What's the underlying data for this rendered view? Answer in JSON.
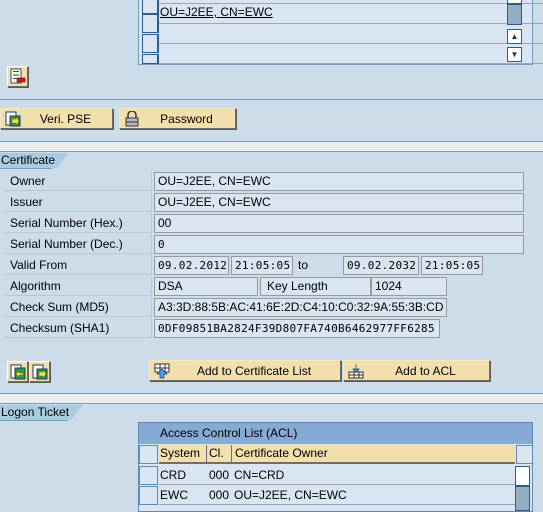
{
  "top_table": {
    "rows": [
      {
        "value": "OU=J2EE, CN=EWC",
        "link": true
      },
      {
        "value": ""
      },
      {
        "value": ""
      }
    ],
    "scroll_up_icon": "triangle-up",
    "scroll_down_icon": "triangle-down"
  },
  "delete_entry_icon": "delete-row-icon",
  "toolbar": {
    "veri_pse_label": "Veri. PSE",
    "password_label": "Password"
  },
  "certificate": {
    "group_title": "Certificate",
    "owner_label": "Owner",
    "owner_value": "OU=J2EE, CN=EWC",
    "issuer_label": "Issuer",
    "issuer_value": "OU=J2EE, CN=EWC",
    "serial_hex_label": "Serial Number (Hex.)",
    "serial_hex_value": "00",
    "serial_dec_label": "Serial Number (Dec.)",
    "serial_dec_value": "0",
    "valid_from_label": "Valid From",
    "valid_from_date": "09.02.2012",
    "valid_from_time": "21:05:05",
    "to_label": "to",
    "valid_to_date": "09.02.2032",
    "valid_to_time": "21:05:05",
    "algorithm_label": "Algorithm",
    "algorithm_value": "DSA",
    "key_length_label": "Key Length",
    "key_length_value": "1024",
    "md5_label": "Check Sum (MD5)",
    "md5_value": "A3:3D:88:5B:AC:41:6E:2D:C4:10:C0:32:9A:55:3B:CD",
    "sha1_label": "Checksum (SHA1)",
    "sha1_value": "0DF09851BA2824F39D807FA740B6462977FF6285"
  },
  "cert_actions": {
    "add_cert_list_label": "Add to Certificate List",
    "add_acl_label": "Add to ACL"
  },
  "logon_ticket": {
    "group_title": "Logon Ticket",
    "acl": {
      "title": "Access Control List (ACL)",
      "columns": [
        "System",
        "Cl.",
        "Certificate Owner"
      ],
      "rows": [
        [
          "CRD",
          "000",
          "CN=CRD"
        ],
        [
          "EWC",
          "000",
          "OU=J2EE, CN=EWC"
        ]
      ]
    }
  }
}
